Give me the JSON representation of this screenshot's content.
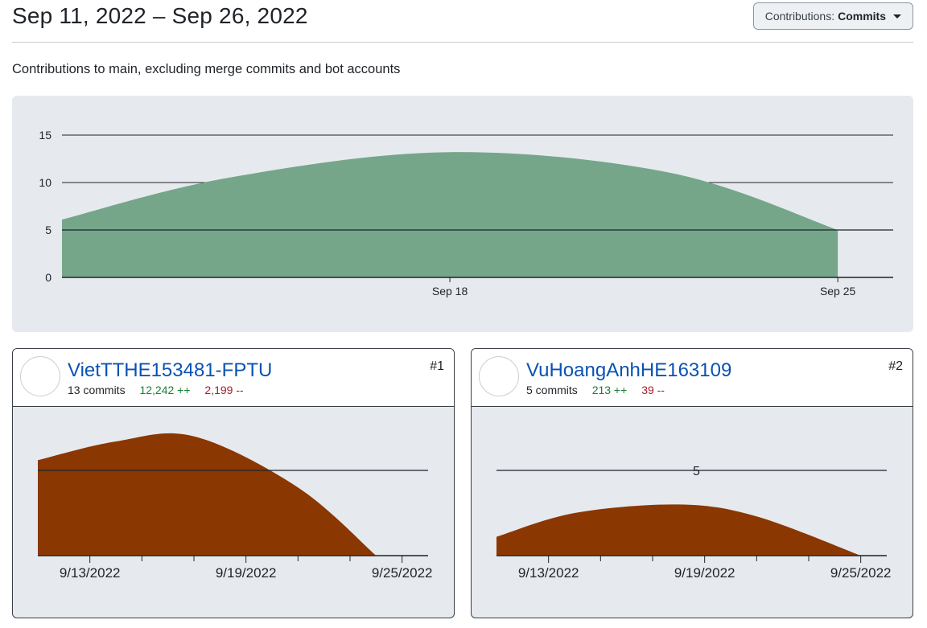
{
  "header": {
    "date_range": "Sep 11, 2022 – Sep 26, 2022",
    "dropdown_prefix": "Contributions:",
    "dropdown_value": "Commits"
  },
  "subtitle": "Contributions to main, excluding merge commits and bot accounts",
  "colors": {
    "overall_area": "#76a68a",
    "contributor_area": "#8b3702",
    "panel_bg": "#e6eaee",
    "link": "#0a52b3",
    "additions": "#1a7f37",
    "deletions": "#a3202e"
  },
  "chart_data": [
    {
      "type": "area",
      "title": "",
      "x": [
        "2022-09-11",
        "2022-09-14",
        "2022-09-18",
        "2022-09-22",
        "2022-09-25"
      ],
      "x_tick_labels": [
        {
          "x": "2022-09-18",
          "label": "Sep 18"
        },
        {
          "x": "2022-09-25",
          "label": "Sep 25"
        }
      ],
      "values": [
        6.1,
        10.5,
        13.2,
        11.0,
        5.0
      ],
      "xlim": [
        "2022-09-11",
        "2022-09-26"
      ],
      "ylim": [
        0,
        15
      ],
      "yticks": [
        0,
        5,
        10,
        15
      ],
      "grid": true
    },
    {
      "type": "area",
      "series_owner": "VietTTHE153481-FPTU",
      "x": [
        "2022-09-11",
        "2022-09-14",
        "2022-09-17",
        "2022-09-21",
        "2022-09-24"
      ],
      "values": [
        5.6,
        6.7,
        7.0,
        4.0,
        0.0
      ],
      "xlim": [
        "2022-09-11",
        "2022-09-26"
      ],
      "ylim": [
        0,
        5
      ],
      "y_gridline": 5,
      "x_tick_labels": [
        "9/13/2022",
        "9/19/2022",
        "9/25/2022"
      ],
      "grid": true
    },
    {
      "type": "area",
      "series_owner": "VuHoangAnhHE163109",
      "x": [
        "2022-09-11",
        "2022-09-14",
        "2022-09-18",
        "2022-09-21",
        "2022-09-25"
      ],
      "values": [
        1.1,
        2.5,
        3.0,
        2.3,
        0.0
      ],
      "xlim": [
        "2022-09-11",
        "2022-09-26"
      ],
      "ylim": [
        0,
        5
      ],
      "y_gridline": 5,
      "y_gridline_label": "5",
      "x_tick_labels": [
        "9/13/2022",
        "9/19/2022",
        "9/25/2022"
      ],
      "grid": true
    }
  ],
  "contributors": [
    {
      "rank": "#1",
      "name": "VietTTHE153481-FPTU",
      "commits": "13 commits",
      "additions": "12,242 ++",
      "deletions": "2,199 --",
      "avatar_icon": "photo-avatar"
    },
    {
      "rank": "#2",
      "name": "VuHoangAnhHE163109",
      "commits": "5 commits",
      "additions": "213 ++",
      "deletions": "39 --",
      "avatar_icon": "identicon-avatar"
    }
  ]
}
